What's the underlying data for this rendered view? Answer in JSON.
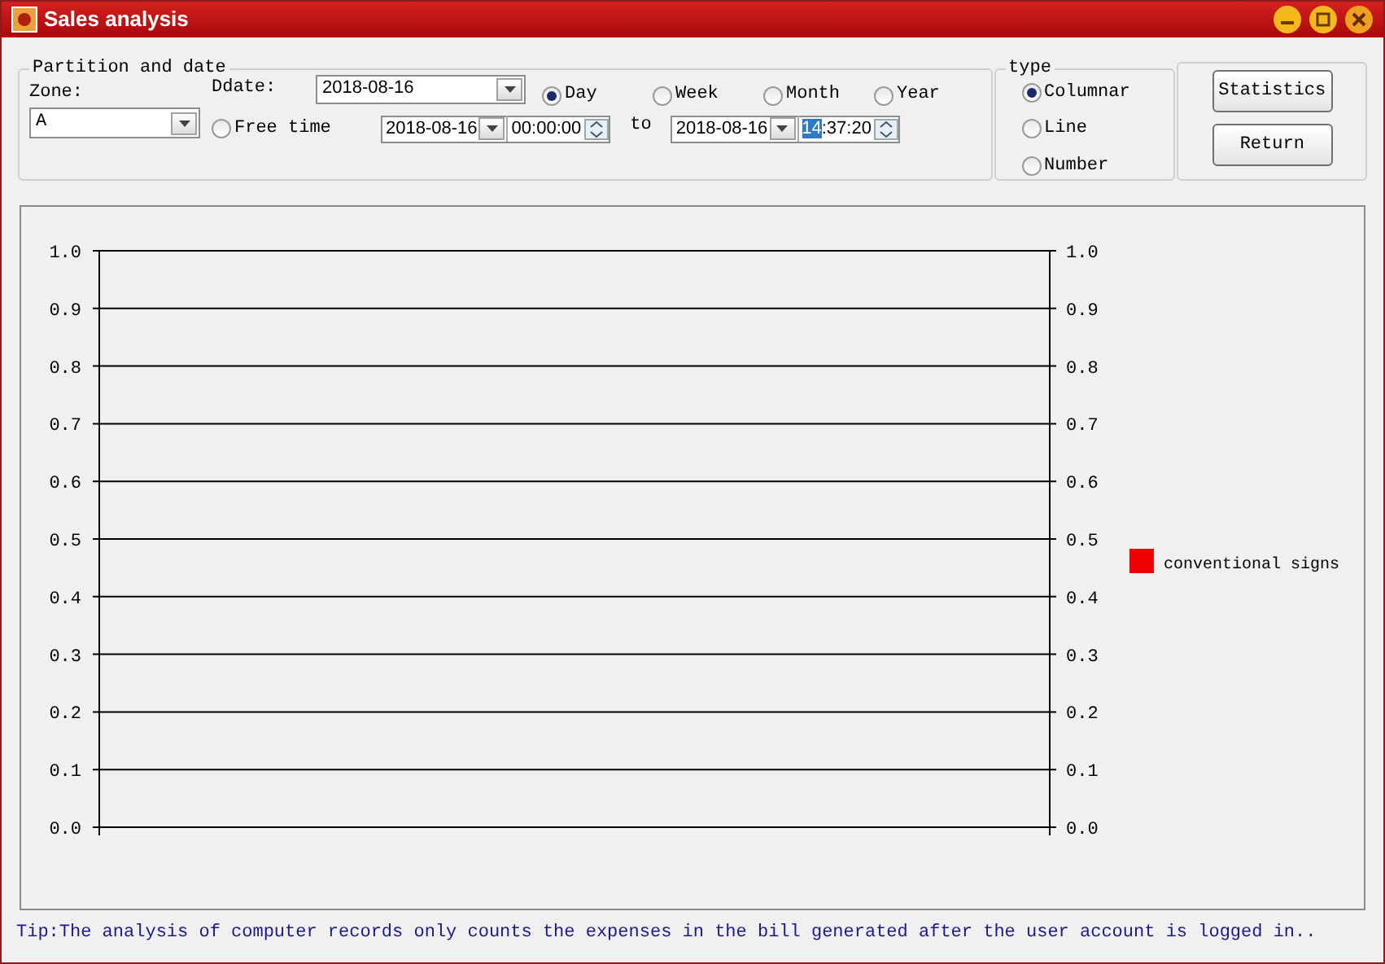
{
  "window": {
    "title": "Sales analysis"
  },
  "partition_group": {
    "title": "Partition and date",
    "zone_label": "Zone:",
    "zone_value": "A",
    "ddate_label": "Ddate:",
    "ddate_value": "2018-08-16",
    "periods": [
      {
        "label": "Day",
        "selected": true
      },
      {
        "label": "Week",
        "selected": false
      },
      {
        "label": "Month",
        "selected": false
      },
      {
        "label": "Year",
        "selected": false
      }
    ],
    "free_time": {
      "label": "Free time",
      "selected": false
    },
    "from_date": "2018-08-16",
    "from_time": {
      "hours": "00",
      "rest": ":00:00",
      "hours_selected": false
    },
    "to_label": "to",
    "to_date": "2018-08-16",
    "to_time": {
      "hours": "14",
      "rest": ":37:20",
      "hours_selected": true
    }
  },
  "type_group": {
    "title": "type",
    "options": [
      {
        "label": "Columnar",
        "selected": true
      },
      {
        "label": "Line",
        "selected": false
      },
      {
        "label": "Number",
        "selected": false
      }
    ]
  },
  "buttons": [
    "Statistics",
    "Return"
  ],
  "chart": {
    "chart_data": {
      "type": "bar",
      "ylim": [
        0,
        1
      ],
      "yticks": [
        {
          "value": 0,
          "label": "0.0"
        },
        {
          "value": 0.1,
          "label": "0.1"
        },
        {
          "value": 0.2,
          "label": "0.2"
        },
        {
          "value": 0.3,
          "label": "0.3"
        },
        {
          "value": 0.4,
          "label": "0.4"
        },
        {
          "value": 0.5,
          "label": "0.5"
        },
        {
          "value": 0.6,
          "label": "0.6"
        },
        {
          "value": 0.7,
          "label": "0.7"
        },
        {
          "value": 0.8,
          "label": "0.8"
        },
        {
          "value": 0.9,
          "label": "0.9"
        },
        {
          "value": 1,
          "label": "1.0"
        }
      ],
      "series": [
        {
          "name": "conventional signs",
          "color": "#ee0000"
        }
      ]
    }
  },
  "tip": "Tip:The analysis of computer records only counts the expenses in the bill generated after the user account is logged in.."
}
